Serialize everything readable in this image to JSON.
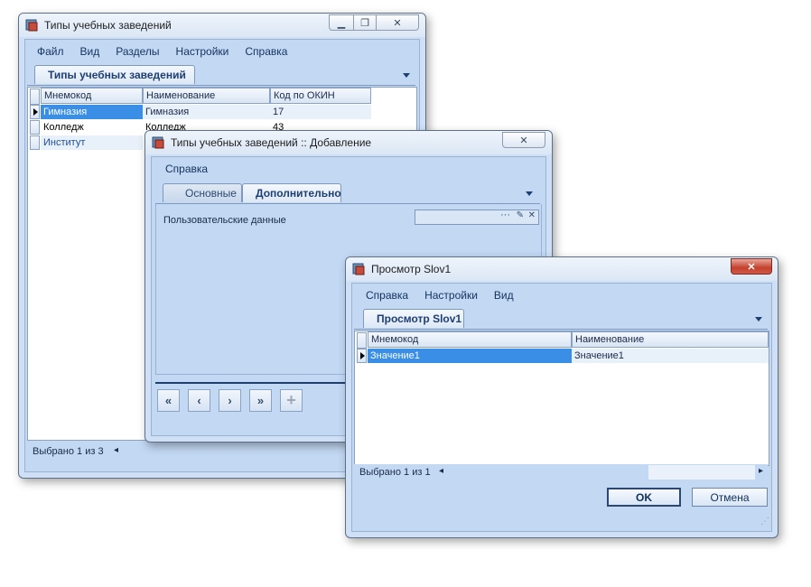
{
  "win1": {
    "title": "Типы учебных заведений",
    "menu": [
      "Файл",
      "Вид",
      "Разделы",
      "Настройки",
      "Справка"
    ],
    "tab": "Типы учебных заведений",
    "columns": [
      "Мнемокод",
      "Наименование",
      "Код по ОКИН"
    ],
    "rows": [
      [
        "Гимназия",
        "Гимназия",
        "17"
      ],
      [
        "Колледж",
        "Колледж",
        "43"
      ],
      [
        "Институт",
        "",
        ""
      ]
    ],
    "status": "Выбрано 1 из 3"
  },
  "win2": {
    "title": "Типы учебных заведений :: Добавление",
    "menu": [
      "Справка"
    ],
    "tabs": [
      "Основные",
      "Дополнительно"
    ],
    "field_label": "Пользовательские данные",
    "field_value": "",
    "nav_first": "«",
    "nav_prev": "‹",
    "nav_next": "›",
    "nav_last": "»",
    "nav_add": "+"
  },
  "win3": {
    "title": "Просмотр Slov1",
    "menu": [
      "Справка",
      "Настройки",
      "Вид"
    ],
    "tab": "Просмотр Slov1",
    "columns": [
      "Мнемокод",
      "Наименование"
    ],
    "rows": [
      [
        "Значение1",
        "Значение1"
      ]
    ],
    "status": "Выбрано 1 из 1",
    "ok_label": "OK",
    "cancel_label": "Отмена"
  },
  "colors": {
    "selection": "#3a8ee6",
    "panel": "#c2d8f3",
    "accent_text": "#1d3f73"
  }
}
